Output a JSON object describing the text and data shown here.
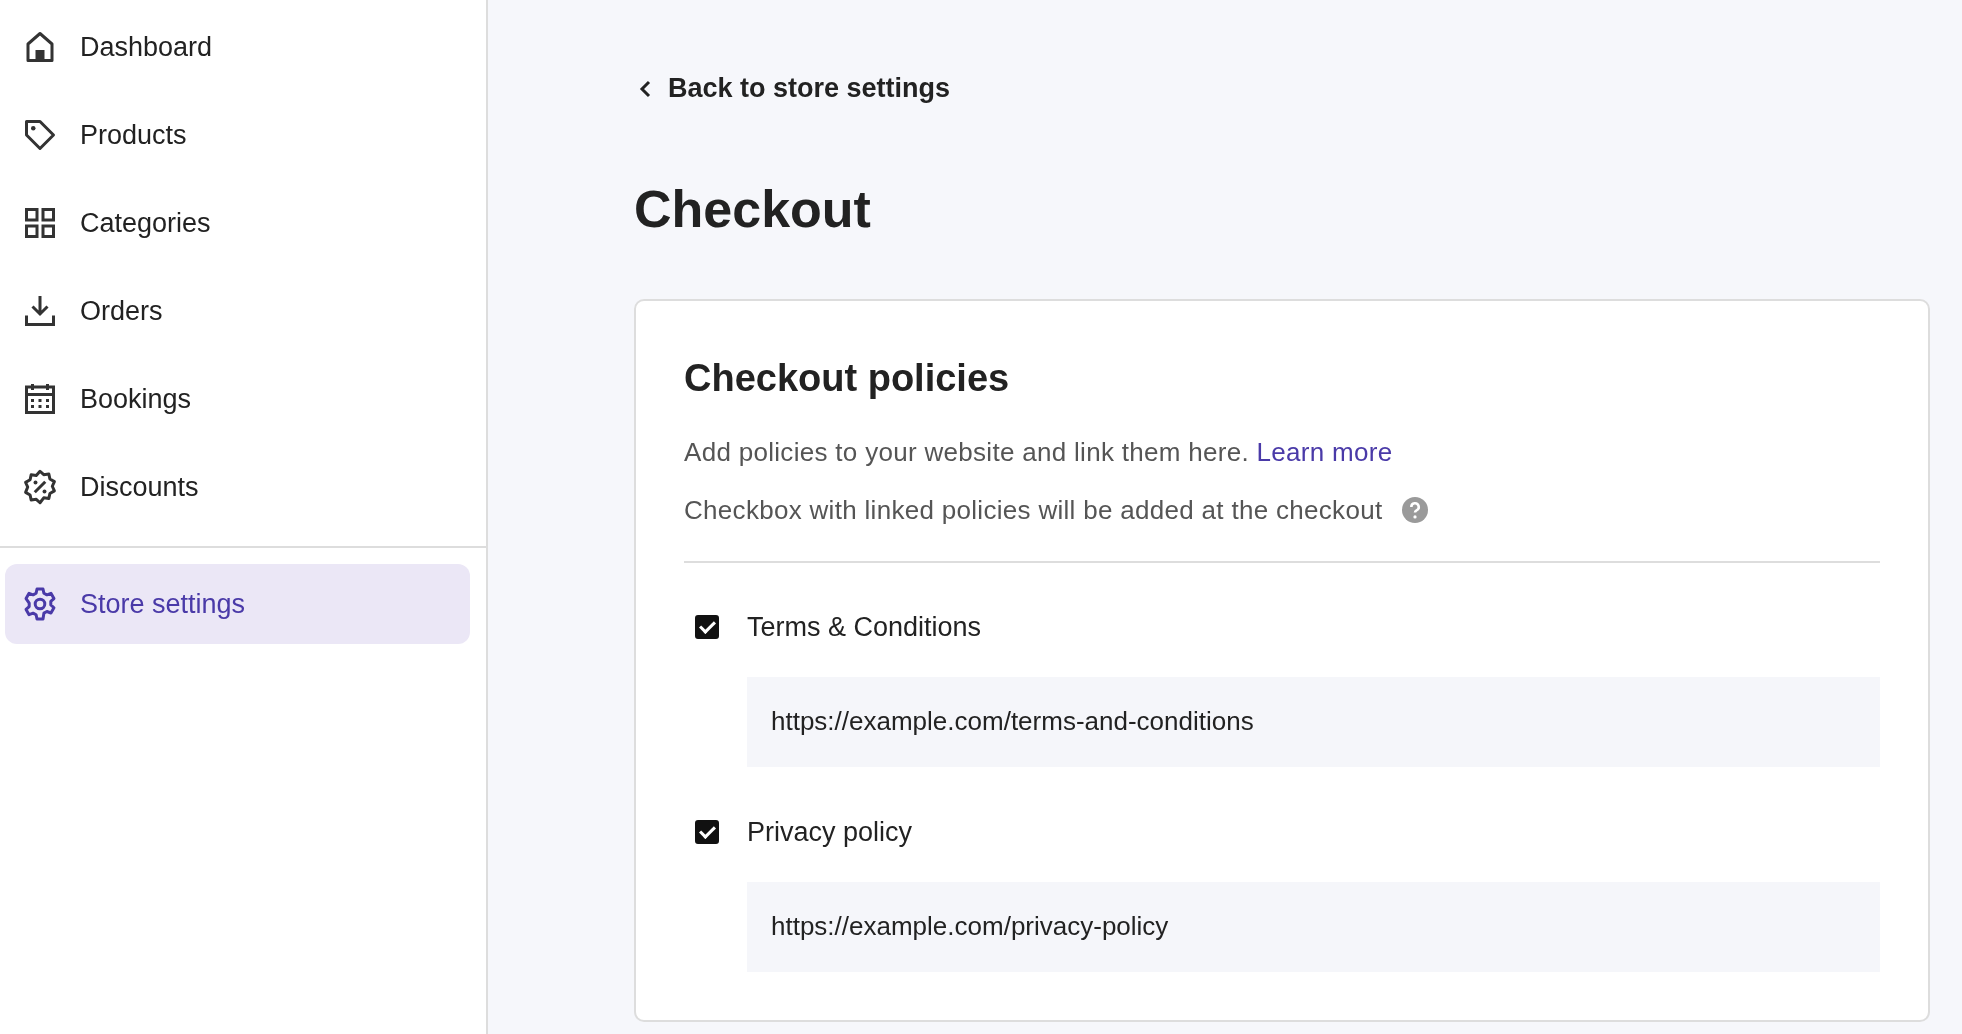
{
  "sidebar": {
    "items": [
      {
        "label": "Dashboard",
        "selected": false
      },
      {
        "label": "Products",
        "selected": false
      },
      {
        "label": "Categories",
        "selected": false
      },
      {
        "label": "Orders",
        "selected": false
      },
      {
        "label": "Bookings",
        "selected": false
      },
      {
        "label": "Discounts",
        "selected": false
      }
    ],
    "footer_items": [
      {
        "label": "Store settings",
        "selected": true
      }
    ]
  },
  "back_link": "Back to store settings",
  "page_title": "Checkout",
  "card": {
    "title": "Checkout policies",
    "description": "Add policies to your website and link them here.",
    "link": "Learn more",
    "note": "Checkbox with linked policies will be added at the checkout",
    "policies": [
      {
        "label": "Terms & Conditions",
        "checked": true,
        "value": "https://example.com/terms-and-conditions"
      },
      {
        "label": "Privacy policy",
        "checked": true,
        "value": "https://example.com/privacy-policy"
      }
    ]
  }
}
